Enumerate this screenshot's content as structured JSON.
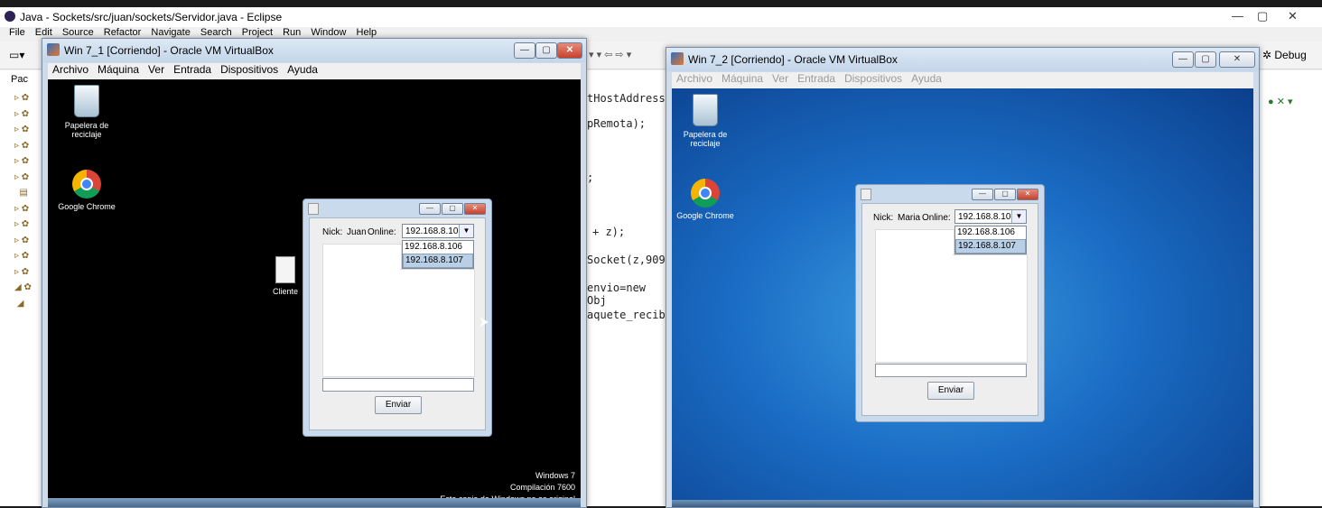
{
  "eclipse": {
    "title": "Java - Sockets/src/juan/sockets/Servidor.java - Eclipse",
    "menu": [
      "File",
      "Edit",
      "Source",
      "Refactor",
      "Navigate",
      "Search",
      "Project",
      "Run",
      "Window",
      "Help"
    ],
    "perspective": "Debug",
    "package_label": "Pac",
    "code_lines": [
      "tHostAddress()",
      "pRemota);",
      ";",
      "+ z);",
      "Socket(z,909",
      "envio=new Obj",
      "aquete_recib"
    ]
  },
  "vm1": {
    "title": "Win 7_1 [Corriendo] - Oracle VM VirtualBox",
    "menu": [
      "Archivo",
      "Máquina",
      "Ver",
      "Entrada",
      "Dispositivos",
      "Ayuda"
    ],
    "recycle_label": "Papelera de reciclaje",
    "chrome_label": "Google Chrome",
    "cliente_label": "Cliente",
    "app": {
      "nick_label": "Nick:",
      "nick_value": "Juan",
      "online_label": "Online:",
      "selected": "192.168.8.106",
      "options": [
        "192.168.8.106",
        "192.168.8.107"
      ],
      "send_label": "Enviar"
    },
    "watermark": [
      "Windows 7",
      "Compilación 7600",
      "Esta copia de Windows no es original"
    ]
  },
  "vm2": {
    "title": "Win 7_2 [Corriendo] - Oracle VM VirtualBox",
    "menu": [
      "Archivo",
      "Máquina",
      "Ver",
      "Entrada",
      "Dispositivos",
      "Ayuda"
    ],
    "recycle_label": "Papelera de reciclaje",
    "chrome_label": "Google Chrome",
    "app": {
      "nick_label": "Nick:",
      "nick_value": "Maria",
      "online_label": "Online:",
      "selected": "192.168.8.106",
      "options": [
        "192.168.8.106",
        "192.168.8.107"
      ],
      "send_label": "Enviar"
    }
  }
}
